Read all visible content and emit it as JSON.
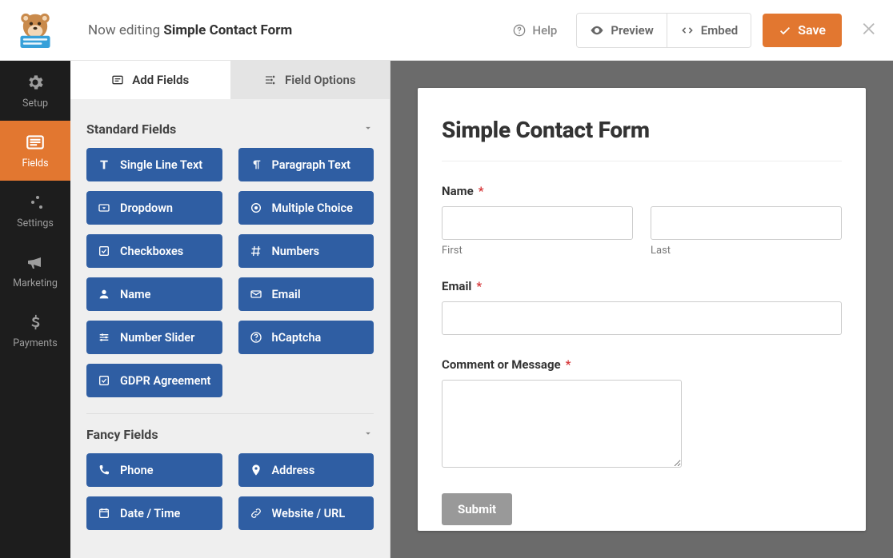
{
  "header": {
    "editing_prefix": "Now editing",
    "form_name": "Simple Contact Form",
    "help": "Help",
    "preview": "Preview",
    "embed": "Embed",
    "save": "Save"
  },
  "sidebar": {
    "items": [
      {
        "name": "setup",
        "label": "Setup",
        "active": false
      },
      {
        "name": "fields",
        "label": "Fields",
        "active": true
      },
      {
        "name": "settings",
        "label": "Settings",
        "active": false
      },
      {
        "name": "marketing",
        "label": "Marketing",
        "active": false
      },
      {
        "name": "payments",
        "label": "Payments",
        "active": false
      }
    ]
  },
  "panel": {
    "tabs": {
      "add_fields": "Add Fields",
      "field_options": "Field Options"
    },
    "sections": [
      {
        "title": "Standard Fields",
        "fields": [
          "Single Line Text",
          "Paragraph Text",
          "Dropdown",
          "Multiple Choice",
          "Checkboxes",
          "Numbers",
          "Name",
          "Email",
          "Number Slider",
          "hCaptcha",
          "GDPR Agreement"
        ]
      },
      {
        "title": "Fancy Fields",
        "fields": [
          "Phone",
          "Address",
          "Date / Time",
          "Website / URL"
        ]
      }
    ]
  },
  "form": {
    "title": "Simple Contact Form",
    "fields": {
      "name": {
        "label": "Name",
        "required": true,
        "sublabels": {
          "first": "First",
          "last": "Last"
        }
      },
      "email": {
        "label": "Email",
        "required": true
      },
      "comment": {
        "label": "Comment or Message",
        "required": true
      }
    },
    "submit": "Submit"
  },
  "colors": {
    "accent": "#e27730",
    "field_button": "#2f5ea3",
    "canvas_bg": "#6b6b6b"
  }
}
